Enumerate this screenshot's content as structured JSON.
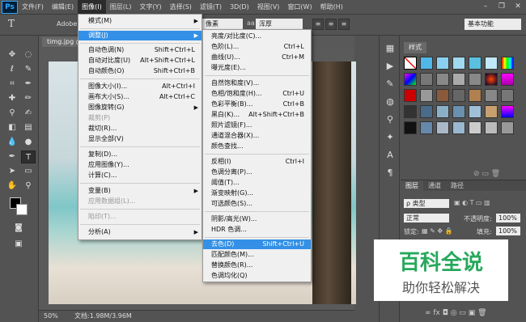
{
  "app": {
    "logo": "Ps"
  },
  "menubar": {
    "items": [
      "文件(F)",
      "编辑(E)",
      "图像(I)",
      "图层(L)",
      "文字(Y)",
      "选择(S)",
      "滤镜(T)",
      "3D(D)",
      "视图(V)",
      "窗口(W)",
      "帮助(H)"
    ],
    "active_index": 2
  },
  "window_controls": {
    "minimize": "–",
    "restore": "❐",
    "close": "✕"
  },
  "options": {
    "tool_glyph": "T",
    "font_name": "Adobe",
    "style_value": "像素",
    "aa_icon": "aa",
    "aa_value": "浑厚",
    "workspace": "基本功能"
  },
  "document": {
    "tab_title": "timg.jpg @",
    "zoom": "50%",
    "doc_info": "文档:1.98M/3.96M"
  },
  "image_menu": {
    "items": [
      {
        "label": "模式(M)",
        "submenu": true
      },
      {
        "label": "调整(J)",
        "submenu": true,
        "highlighted": true
      },
      {
        "label": "自动色调(N)",
        "shortcut": "Shift+Ctrl+L"
      },
      {
        "label": "自动对比度(U)",
        "shortcut": "Alt+Shift+Ctrl+L"
      },
      {
        "label": "自动颜色(O)",
        "shortcut": "Shift+Ctrl+B"
      },
      {
        "label": "图像大小(I)...",
        "shortcut": "Alt+Ctrl+I"
      },
      {
        "label": "画布大小(S)...",
        "shortcut": "Alt+Ctrl+C"
      },
      {
        "label": "图像旋转(G)",
        "submenu": true
      },
      {
        "label": "裁剪(P)",
        "disabled": true
      },
      {
        "label": "裁切(R)..."
      },
      {
        "label": "显示全部(V)"
      },
      {
        "label": "复制(D)..."
      },
      {
        "label": "应用图像(Y)..."
      },
      {
        "label": "计算(C)..."
      },
      {
        "label": "变量(B)",
        "submenu": true
      },
      {
        "label": "应用数据组(L)...",
        "disabled": true
      },
      {
        "label": "陷印(T)...",
        "disabled": true
      },
      {
        "label": "分析(A)",
        "submenu": true
      }
    ]
  },
  "adjust_menu": {
    "items": [
      {
        "label": "亮度/对比度(C)..."
      },
      {
        "label": "色阶(L)...",
        "shortcut": "Ctrl+L"
      },
      {
        "label": "曲线(U)...",
        "shortcut": "Ctrl+M"
      },
      {
        "label": "曝光度(E)..."
      },
      {
        "label": "自然饱和度(V)..."
      },
      {
        "label": "色相/饱和度(H)...",
        "shortcut": "Ctrl+U"
      },
      {
        "label": "色彩平衡(B)...",
        "shortcut": "Ctrl+B"
      },
      {
        "label": "黑白(K)...",
        "shortcut": "Alt+Shift+Ctrl+B"
      },
      {
        "label": "照片滤镜(F)..."
      },
      {
        "label": "通道混合器(X)..."
      },
      {
        "label": "颜色查找..."
      },
      {
        "label": "反相(I)",
        "shortcut": "Ctrl+I"
      },
      {
        "label": "色调分离(P)..."
      },
      {
        "label": "阈值(T)..."
      },
      {
        "label": "渐变映射(G)..."
      },
      {
        "label": "可选颜色(S)..."
      },
      {
        "label": "阴影/高光(W)..."
      },
      {
        "label": "HDR 色调..."
      },
      {
        "label": "去色(D)",
        "shortcut": "Shift+Ctrl+U",
        "highlighted": true
      },
      {
        "label": "匹配颜色(M)..."
      },
      {
        "label": "替换颜色(R)..."
      },
      {
        "label": "色调均化(Q)"
      }
    ]
  },
  "panels": {
    "styles_tab": "样式",
    "layers_tabs": [
      "图层",
      "通道",
      "路径"
    ],
    "kind_label": "ρ 类型",
    "blend_mode": "正常",
    "opacity_label": "不透明度:",
    "opacity_value": "100%",
    "lock_label": "锁定:",
    "fill_label": "填充:",
    "fill_value": "100%",
    "footer_icons": "∞ fx ◘ ◎ ▭ ▣ 🗑"
  },
  "watermark": {
    "title": "百科全说",
    "subtitle": "助你轻松解决"
  },
  "colors": {
    "accent": "#3390e6",
    "watermark_green": "#27a85c",
    "panel": "#535353"
  }
}
